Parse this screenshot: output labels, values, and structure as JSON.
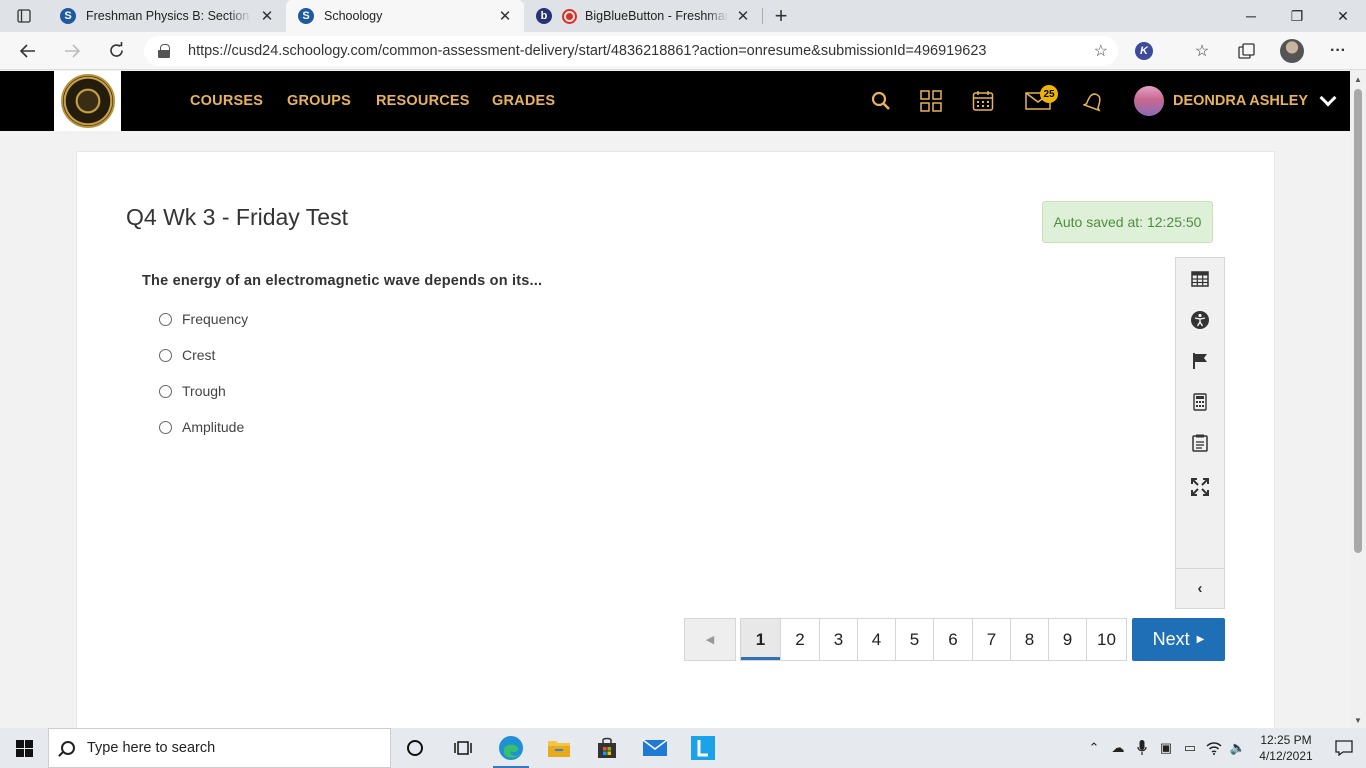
{
  "browser": {
    "tabs": [
      {
        "title": "Freshman Physics B: Section 1 | S",
        "favicon": "schoology-icon",
        "active": false
      },
      {
        "title": "Schoology",
        "favicon": "schoology-icon",
        "active": true
      },
      {
        "title": "BigBlueButton - Freshman P",
        "favicon": "bigbluebutton-icon",
        "active": false
      }
    ],
    "favicon_letters": {
      "schoology": "S",
      "bbb": "b"
    },
    "url": "https://cusd24.schoology.com/common-assessment-delivery/start/4836218861?action=onresume&submissionId=496919623",
    "extension_letter": "K"
  },
  "header": {
    "nav": [
      "COURSES",
      "GROUPS",
      "RESOURCES",
      "GRADES"
    ],
    "messages_badge": "25",
    "user_name": "DEONDRA ASHLEY",
    "accent_color": "#e8b35a"
  },
  "test": {
    "title": "Q4 Wk 3 - Friday Test",
    "autosave": "Auto saved at: 12:25:50",
    "question": "The energy of an electromagnetic wave depends on its...",
    "options": [
      "Frequency",
      "Crest",
      "Trough",
      "Amplitude"
    ],
    "pages": [
      "1",
      "2",
      "3",
      "4",
      "5",
      "6",
      "7",
      "8",
      "9",
      "10"
    ],
    "current_page": "1",
    "next_label": "Next"
  },
  "taskbar": {
    "search_placeholder": "Type here to search",
    "time": "12:25 PM",
    "date": "4/12/2021"
  }
}
